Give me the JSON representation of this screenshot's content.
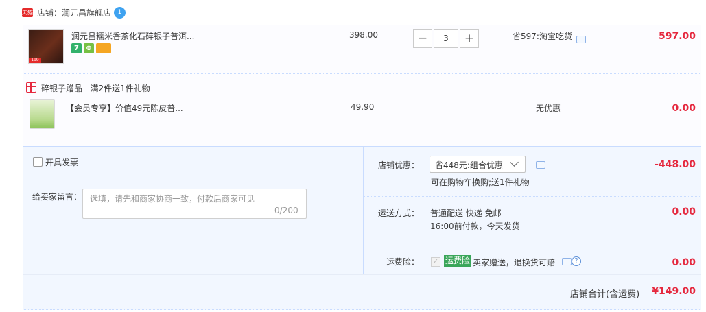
{
  "shop": {
    "badge": "天猫",
    "name": "店铺：润元昌旗舰店",
    "chat_badge": "1"
  },
  "item": {
    "img_tag": "199",
    "title": "润元昌糯米香茶化石碎银子普洱...",
    "unit_price": "398.00",
    "quantity": "3",
    "qty_minus": "−",
    "qty_plus": "+",
    "promo": "省597:淘宝吃货",
    "subtotal": "597.00",
    "service_icons": [
      "seven-day-return-icon",
      "guarantee-icon",
      "card-payment-icon"
    ],
    "service_text": [
      "7",
      "⊕",
      ""
    ]
  },
  "gift": {
    "section_label": "碎银子赠品",
    "rule": "满2件送1件礼物",
    "title": "【会员专享】价值49元陈皮普...",
    "price": "49.90",
    "promo": "无优惠",
    "subtotal": "0.00"
  },
  "order": {
    "invoice_label": "开具发票",
    "memo_label": "给卖家留言：",
    "memo_placeholder": "选填，请先和商家协商一致，付款后商家可见",
    "memo_count": "0/200",
    "shop_discount_label": "店铺优惠：",
    "shop_discount_value": "省448元:组合优惠",
    "shop_discount_note": "可在购物车换购;送1件礼物",
    "shop_discount_amount": "-448.00",
    "shipping_label": "运送方式：",
    "shipping_method": "普通配送 快递 免邮",
    "shipping_note": "16:00前付款，今天发货",
    "shipping_amount": "0.00",
    "insurance_label": "运费险：",
    "insurance_badge": "运费险",
    "insurance_text": "卖家赠送，退换货可赔",
    "insurance_amount": "0.00",
    "help": "?"
  },
  "total": {
    "label": "店铺合计(含运费)",
    "amount": "¥149.00"
  },
  "colors": {
    "price_red": "#e5283e",
    "panel_blue": "#f2f7ff",
    "border_blue": "#c9dcff",
    "badge_green": "#3aa65a"
  }
}
